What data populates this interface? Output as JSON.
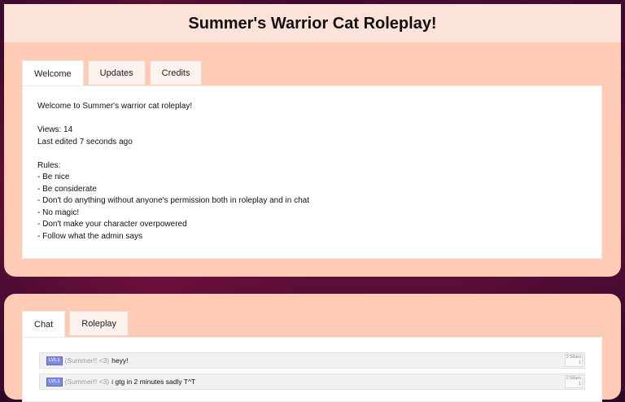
{
  "header": {
    "title": "Summer's Warrior Cat Roleplay!"
  },
  "info_tabs": [
    "Welcome",
    "Updates",
    "Credits"
  ],
  "welcome": {
    "greeting": "Welcome to Summer's warrior cat roleplay!",
    "views": "Views: 14",
    "last_edited": "Last edited 7 seconds ago",
    "rules_heading": "Rules:",
    "rules": [
      "- Be nice",
      "- Be considerate",
      "- Don't do anything without anyone's permission both in roleplay and in chat",
      "- No magic!",
      "- Don't make your character overpowered",
      "- Follow what the admin says"
    ]
  },
  "chat_tabs": [
    "Chat",
    "Roleplay"
  ],
  "chat": {
    "messages": [
      {
        "badge": "LVL1",
        "user": "(Summer!! <3)",
        "text": "heyy!",
        "time": "2:58am",
        "count": "1"
      },
      {
        "badge": "LVL1",
        "user": "(Summer!! <3)",
        "text": "i gtg in 2 minutes sadly T^T",
        "time": "2:58am",
        "count": "1"
      }
    ]
  },
  "colors": {
    "header_bg": "#fce3da",
    "panel_bg": "#ffcbb4",
    "badge_bg": "#7f8be0"
  }
}
